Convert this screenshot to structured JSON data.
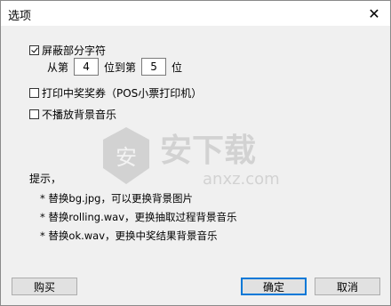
{
  "window": {
    "title": "选项",
    "close_glyph": "✕"
  },
  "options": {
    "mask_label": "屏蔽部分字符",
    "mask_checked": true,
    "from_label": "从第",
    "from_value": "4",
    "to_label": "位到第",
    "to_value": "5",
    "unit_label": "位",
    "print_label": "打印中奖奖券（POS小票打印机）",
    "print_checked": false,
    "nomusic_label": "不播放背景音乐",
    "nomusic_checked": false
  },
  "hints": {
    "title": "提示，",
    "lines": [
      "* 替换bg.jpg，可以更换背景图片",
      "* 替换rolling.wav，更换抽取过程背景音乐",
      "* 替换ok.wav，更换中奖结果背景音乐"
    ]
  },
  "buttons": {
    "buy": "购买",
    "ok": "确定",
    "cancel": "取消"
  },
  "watermark": {
    "brand": "安下载",
    "domain": "anxz.com"
  }
}
